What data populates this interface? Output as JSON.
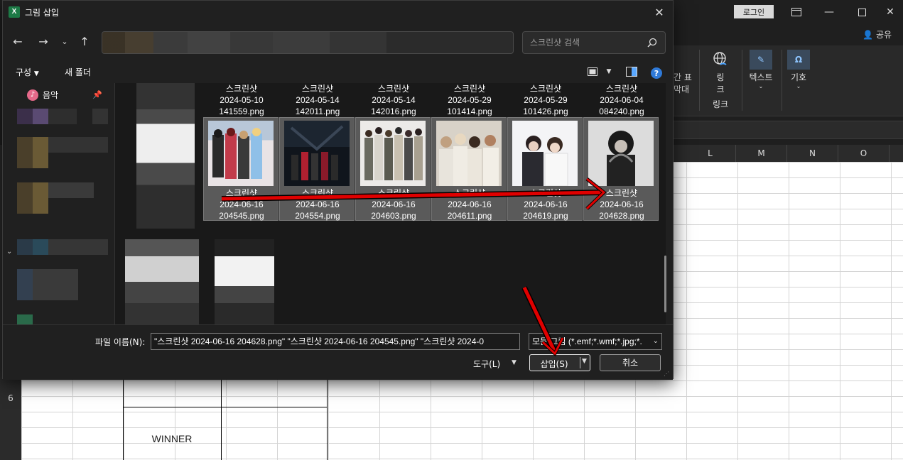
{
  "excel": {
    "login_label": "로그인",
    "share_label": "공유",
    "ribbon": {
      "table_label_1": "간 표",
      "table_label_2": "막대",
      "link_label_1": "링",
      "link_label_2": "크",
      "link_group": "링크",
      "text_label": "텍스트",
      "symbol_label": "기호"
    },
    "columns": [
      "L",
      "M",
      "N",
      "O"
    ],
    "row_number": "6",
    "cell_winner": "WINNER"
  },
  "dialog": {
    "title": "그림 삽입",
    "search_placeholder": "스크린샷 검색",
    "commands": {
      "organize": "구성",
      "new_folder": "새 폴더"
    },
    "nav_pane": {
      "music_label": "음악"
    },
    "top_row_files": [
      {
        "line1": "스크린샷",
        "line2": "2024-05-10",
        "line3": "141559.png"
      },
      {
        "line1": "스크린샷",
        "line2": "2024-05-14",
        "line3": "142011.png"
      },
      {
        "line1": "스크린샷",
        "line2": "2024-05-14",
        "line3": "142016.png"
      },
      {
        "line1": "스크린샷",
        "line2": "2024-05-29",
        "line3": "101414.png"
      },
      {
        "line1": "스크린샷",
        "line2": "2024-05-29",
        "line3": "101426.png"
      },
      {
        "line1": "스크린샷",
        "line2": "2024-06-04",
        "line3": "084240.png"
      }
    ],
    "selected_files": [
      {
        "line1": "스크린샷",
        "line2": "2024-06-16",
        "line3": "204545.png"
      },
      {
        "line1": "스크린샷",
        "line2": "2024-06-16",
        "line3": "204554.png"
      },
      {
        "line1": "스크린샷",
        "line2": "2024-06-16",
        "line3": "204603.png"
      },
      {
        "line1": "스크린샷",
        "line2": "2024-06-16",
        "line3": "204611.png"
      },
      {
        "line1": "스크린샷",
        "line2": "2024-06-16",
        "line3": "204619.png"
      },
      {
        "line1": "스크린샷",
        "line2": "2024-06-16",
        "line3": "204628.png"
      }
    ],
    "footer": {
      "filename_label": "파일 이름(N):",
      "filename_value": "\"스크린샷 2024-06-16 204628.png\" \"스크린샷 2024-06-16 204545.png\" \"스크린샷 2024-0",
      "filetype_value": "모든 그림 (*.emf;*.wmf;*.jpg;*.",
      "tools_label": "도구(L)",
      "insert_label": "삽입(S)",
      "cancel_label": "취소"
    }
  },
  "colors": {
    "annotation_red": "#e00000",
    "accent_blue": "#2f7ad8",
    "excel_green": "#1d7a46"
  }
}
